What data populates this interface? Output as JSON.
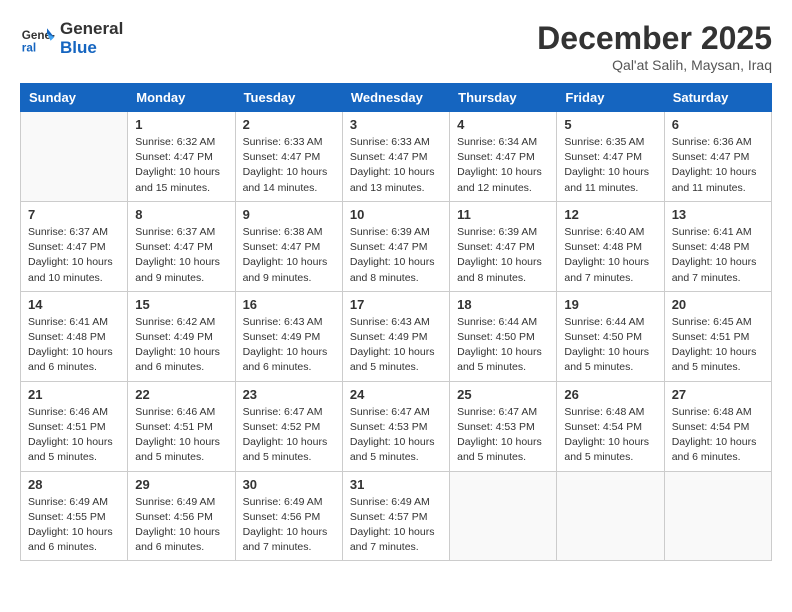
{
  "header": {
    "logo_line1": "General",
    "logo_line2": "Blue",
    "month_title": "December 2025",
    "location": "Qal'at Salih, Maysan, Iraq"
  },
  "weekdays": [
    "Sunday",
    "Monday",
    "Tuesday",
    "Wednesday",
    "Thursday",
    "Friday",
    "Saturday"
  ],
  "weeks": [
    [
      {
        "day": "",
        "info": ""
      },
      {
        "day": "1",
        "info": "Sunrise: 6:32 AM\nSunset: 4:47 PM\nDaylight: 10 hours and 15 minutes."
      },
      {
        "day": "2",
        "info": "Sunrise: 6:33 AM\nSunset: 4:47 PM\nDaylight: 10 hours and 14 minutes."
      },
      {
        "day": "3",
        "info": "Sunrise: 6:33 AM\nSunset: 4:47 PM\nDaylight: 10 hours and 13 minutes."
      },
      {
        "day": "4",
        "info": "Sunrise: 6:34 AM\nSunset: 4:47 PM\nDaylight: 10 hours and 12 minutes."
      },
      {
        "day": "5",
        "info": "Sunrise: 6:35 AM\nSunset: 4:47 PM\nDaylight: 10 hours and 11 minutes."
      },
      {
        "day": "6",
        "info": "Sunrise: 6:36 AM\nSunset: 4:47 PM\nDaylight: 10 hours and 11 minutes."
      }
    ],
    [
      {
        "day": "7",
        "info": "Sunrise: 6:37 AM\nSunset: 4:47 PM\nDaylight: 10 hours and 10 minutes."
      },
      {
        "day": "8",
        "info": "Sunrise: 6:37 AM\nSunset: 4:47 PM\nDaylight: 10 hours and 9 minutes."
      },
      {
        "day": "9",
        "info": "Sunrise: 6:38 AM\nSunset: 4:47 PM\nDaylight: 10 hours and 9 minutes."
      },
      {
        "day": "10",
        "info": "Sunrise: 6:39 AM\nSunset: 4:47 PM\nDaylight: 10 hours and 8 minutes."
      },
      {
        "day": "11",
        "info": "Sunrise: 6:39 AM\nSunset: 4:47 PM\nDaylight: 10 hours and 8 minutes."
      },
      {
        "day": "12",
        "info": "Sunrise: 6:40 AM\nSunset: 4:48 PM\nDaylight: 10 hours and 7 minutes."
      },
      {
        "day": "13",
        "info": "Sunrise: 6:41 AM\nSunset: 4:48 PM\nDaylight: 10 hours and 7 minutes."
      }
    ],
    [
      {
        "day": "14",
        "info": "Sunrise: 6:41 AM\nSunset: 4:48 PM\nDaylight: 10 hours and 6 minutes."
      },
      {
        "day": "15",
        "info": "Sunrise: 6:42 AM\nSunset: 4:49 PM\nDaylight: 10 hours and 6 minutes."
      },
      {
        "day": "16",
        "info": "Sunrise: 6:43 AM\nSunset: 4:49 PM\nDaylight: 10 hours and 6 minutes."
      },
      {
        "day": "17",
        "info": "Sunrise: 6:43 AM\nSunset: 4:49 PM\nDaylight: 10 hours and 5 minutes."
      },
      {
        "day": "18",
        "info": "Sunrise: 6:44 AM\nSunset: 4:50 PM\nDaylight: 10 hours and 5 minutes."
      },
      {
        "day": "19",
        "info": "Sunrise: 6:44 AM\nSunset: 4:50 PM\nDaylight: 10 hours and 5 minutes."
      },
      {
        "day": "20",
        "info": "Sunrise: 6:45 AM\nSunset: 4:51 PM\nDaylight: 10 hours and 5 minutes."
      }
    ],
    [
      {
        "day": "21",
        "info": "Sunrise: 6:46 AM\nSunset: 4:51 PM\nDaylight: 10 hours and 5 minutes."
      },
      {
        "day": "22",
        "info": "Sunrise: 6:46 AM\nSunset: 4:51 PM\nDaylight: 10 hours and 5 minutes."
      },
      {
        "day": "23",
        "info": "Sunrise: 6:47 AM\nSunset: 4:52 PM\nDaylight: 10 hours and 5 minutes."
      },
      {
        "day": "24",
        "info": "Sunrise: 6:47 AM\nSunset: 4:53 PM\nDaylight: 10 hours and 5 minutes."
      },
      {
        "day": "25",
        "info": "Sunrise: 6:47 AM\nSunset: 4:53 PM\nDaylight: 10 hours and 5 minutes."
      },
      {
        "day": "26",
        "info": "Sunrise: 6:48 AM\nSunset: 4:54 PM\nDaylight: 10 hours and 5 minutes."
      },
      {
        "day": "27",
        "info": "Sunrise: 6:48 AM\nSunset: 4:54 PM\nDaylight: 10 hours and 6 minutes."
      }
    ],
    [
      {
        "day": "28",
        "info": "Sunrise: 6:49 AM\nSunset: 4:55 PM\nDaylight: 10 hours and 6 minutes."
      },
      {
        "day": "29",
        "info": "Sunrise: 6:49 AM\nSunset: 4:56 PM\nDaylight: 10 hours and 6 minutes."
      },
      {
        "day": "30",
        "info": "Sunrise: 6:49 AM\nSunset: 4:56 PM\nDaylight: 10 hours and 7 minutes."
      },
      {
        "day": "31",
        "info": "Sunrise: 6:49 AM\nSunset: 4:57 PM\nDaylight: 10 hours and 7 minutes."
      },
      {
        "day": "",
        "info": ""
      },
      {
        "day": "",
        "info": ""
      },
      {
        "day": "",
        "info": ""
      }
    ]
  ]
}
